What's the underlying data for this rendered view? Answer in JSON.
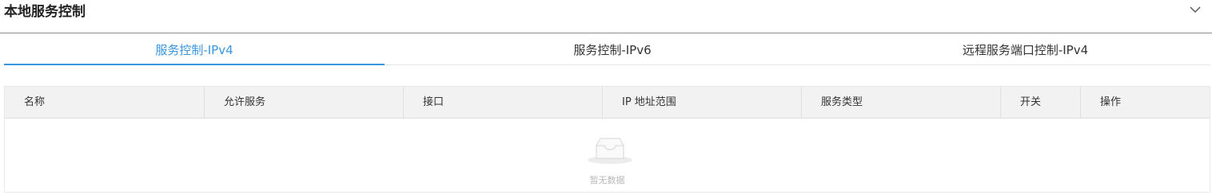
{
  "panel": {
    "title": "本地服务控制",
    "toggle_icon": "chevron-down-icon"
  },
  "tabs": [
    {
      "label": "服务控制-IPv4",
      "active": true
    },
    {
      "label": "服务控制-IPv6",
      "active": false
    },
    {
      "label": "远程服务端口控制-IPv4",
      "active": false
    }
  ],
  "table": {
    "columns": [
      "名称",
      "允许服务",
      "接口",
      "IP 地址范围",
      "服务类型",
      "开关",
      "操作"
    ],
    "rows": [],
    "empty_icon": "empty-inbox-icon",
    "empty_text": "暂无数据"
  },
  "colors": {
    "accent": "#3a95dd",
    "header_bg": "#f2f2f2",
    "border": "#e8e8e8",
    "empty_text": "#b8b8b8"
  }
}
